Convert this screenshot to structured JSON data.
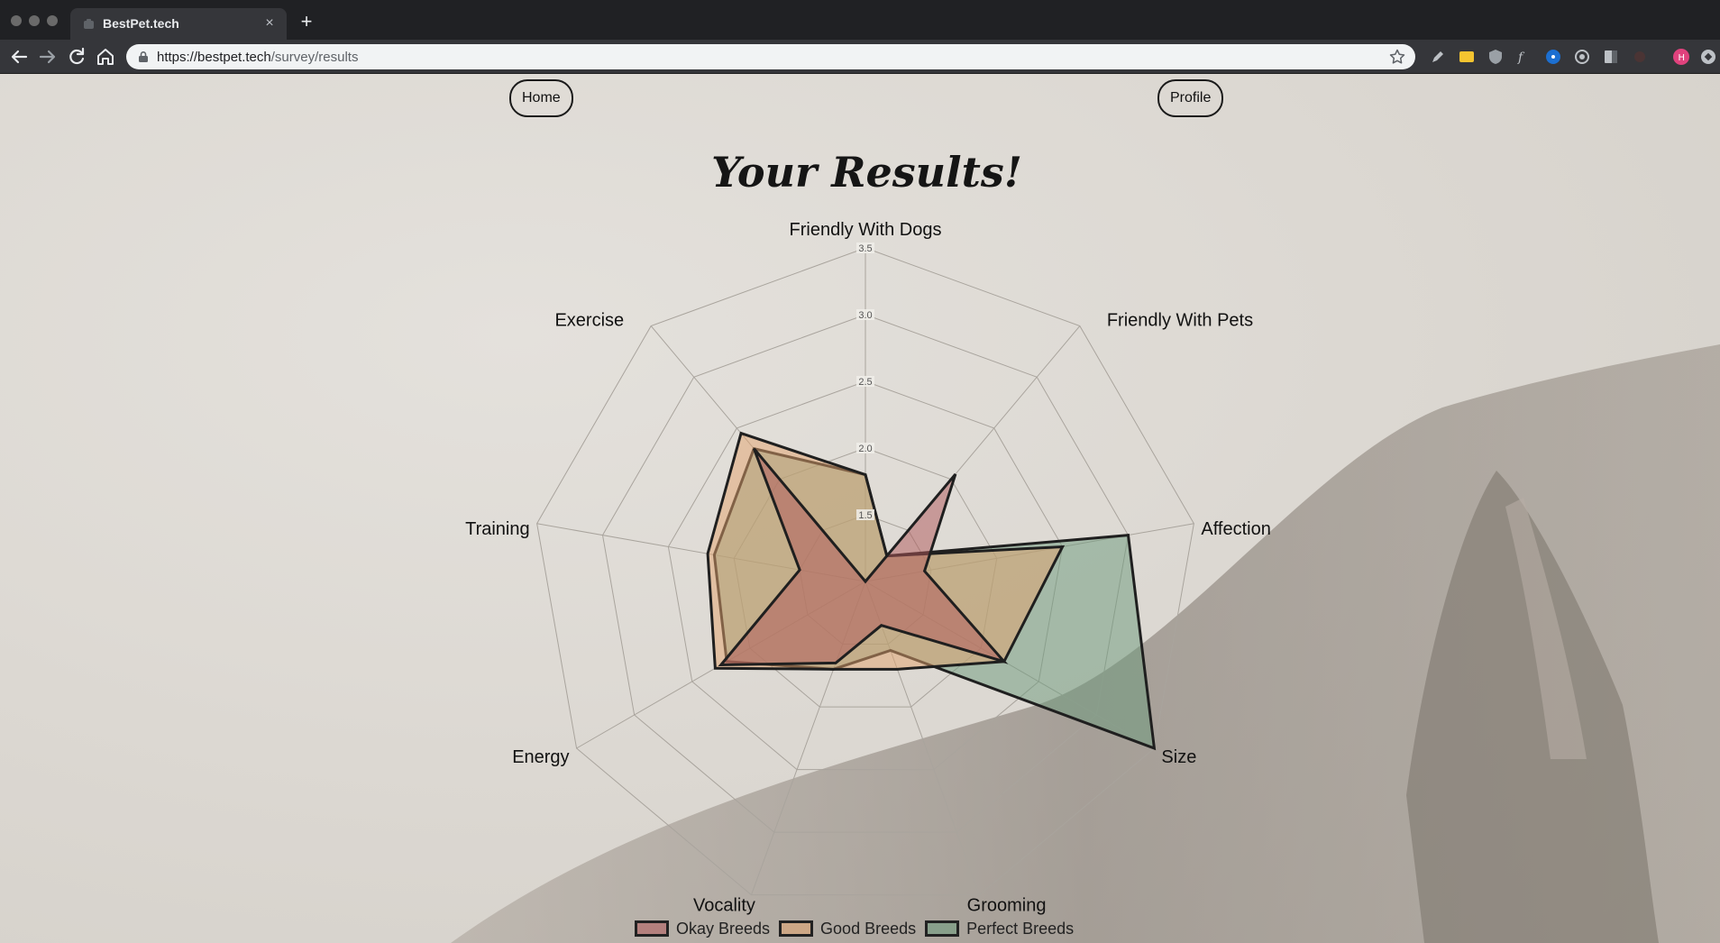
{
  "browser": {
    "tab_title": "BestPet.tech",
    "tab_close": "×",
    "new_tab": "+",
    "url_host": "https://bestpet.tech",
    "url_path": "/survey/results"
  },
  "nav": {
    "home_label": "Home",
    "profile_label": "Profile"
  },
  "page": {
    "title": "Your Results!"
  },
  "chart_data": {
    "type": "radar",
    "axes": [
      "Friendly With Dogs",
      "Friendly With Pets",
      "Affection",
      "Size",
      "Grooming",
      "Vocality",
      "Energy",
      "Training",
      "Exercise"
    ],
    "r_ticks": [
      "1.5",
      "2.0",
      "2.5",
      "3.0",
      "3.5"
    ],
    "r_range": [
      1,
      3.5
    ],
    "grid": true,
    "legend_position": "bottom",
    "series": [
      {
        "name": "Okay Breeds",
        "values": [
          1,
          2.05,
          1.45,
          2.2,
          1.35,
          1.65,
          2.25,
          1.5,
          2.3
        ],
        "color": "#b0585a"
      },
      {
        "name": "Good Breeds",
        "values": [
          1.8,
          1.25,
          2.5,
          2.2,
          1.7,
          1.7,
          2.3,
          2.2,
          2.45
        ],
        "color": "#e3a46e"
      },
      {
        "name": "Perfect Breeds",
        "values": [
          1.8,
          1.25,
          3,
          3.5,
          1.55,
          1.7,
          2.2,
          2.15,
          2.3
        ],
        "color": "#6b9a7c"
      }
    ],
    "draw_order": [
      2,
      1,
      0
    ]
  }
}
